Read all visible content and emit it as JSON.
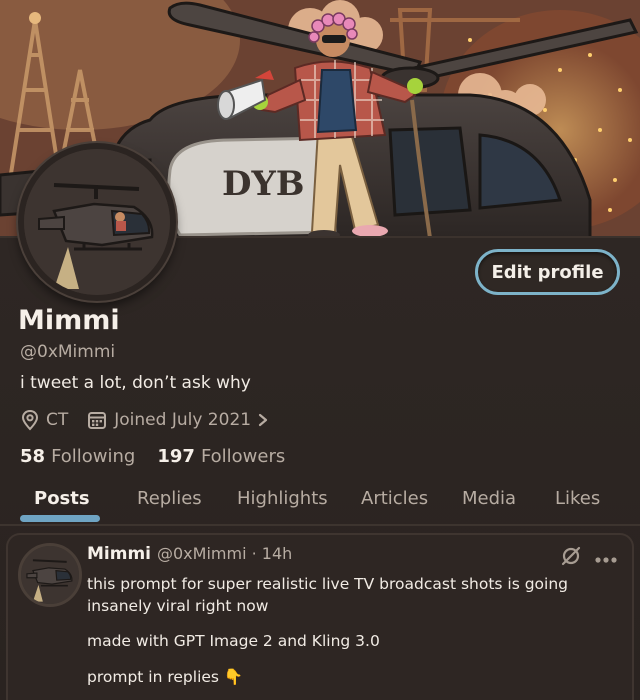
{
  "banner": {
    "sign_text": "DYB"
  },
  "profile": {
    "name": "Mimmi",
    "handle": "@0xMimmi",
    "bio": "i tweet a lot, don’t ask why",
    "location": "CT",
    "joined": "Joined July 2021",
    "following_count": "58",
    "following_label": "Following",
    "followers_count": "197",
    "followers_label": "Followers",
    "edit_label": "Edit profile"
  },
  "tabs": [
    {
      "label": "Posts",
      "active": true
    },
    {
      "label": "Replies",
      "active": false
    },
    {
      "label": "Highlights",
      "active": false
    },
    {
      "label": "Articles",
      "active": false
    },
    {
      "label": "Media",
      "active": false
    },
    {
      "label": "Likes",
      "active": false
    }
  ],
  "tweet": {
    "author_name": "Mimmi",
    "author_meta": "@0xMimmi · 14h",
    "line1": "this prompt for super realistic live TV broadcast shots is going insanely viral right now",
    "line2": "made with GPT Image 2 and Kling 3.0",
    "line3": "prompt in replies 👇"
  },
  "icons": [
    "location-pin-icon",
    "calendar-icon",
    "chevron-right-icon",
    "grok-icon",
    "more-icon"
  ],
  "colors": {
    "accent": "#6fa4c3",
    "edit_border": "#7db3c9",
    "background": "#2c2522"
  }
}
